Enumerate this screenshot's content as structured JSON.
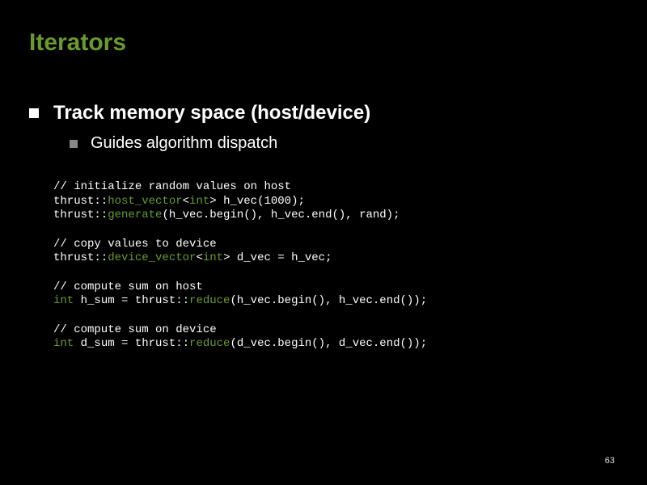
{
  "title": "Iterators",
  "bullets": {
    "l1": "Track memory space (host/device)",
    "l2": "Guides algorithm dispatch"
  },
  "code": {
    "g1_c1": "// initialize random values on host",
    "g1_l2_a": "thrust::",
    "g1_l2_b": "host_vector",
    "g1_l2_c": "<",
    "g1_l2_d": "int",
    "g1_l2_e": "> h_vec(1000);",
    "g1_l3_a": "thrust::",
    "g1_l3_b": "generate",
    "g1_l3_c": "(h_vec.begin(), h_vec.end(), rand);",
    "g2_c1": "// copy values to device",
    "g2_l2_a": "thrust::",
    "g2_l2_b": "device_vector",
    "g2_l2_c": "<",
    "g2_l2_d": "int",
    "g2_l2_e": "> d_vec = h_vec;",
    "g3_c1": "// compute sum on host",
    "g3_l2_a": "int",
    "g3_l2_b": " h_sum = thrust::",
    "g3_l2_c": "reduce",
    "g3_l2_d": "(h_vec.begin(), h_vec.end());",
    "g4_c1": "// compute sum on device",
    "g4_l2_a": "int",
    "g4_l2_b": " d_sum = thrust::",
    "g4_l2_c": "reduce",
    "g4_l2_d": "(d_vec.begin(), d_vec.end());"
  },
  "page_number": "63"
}
